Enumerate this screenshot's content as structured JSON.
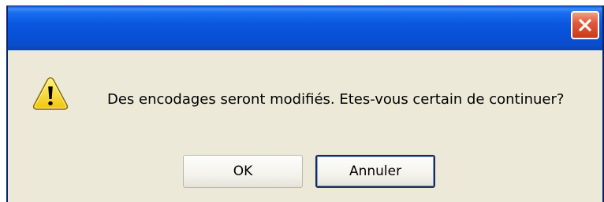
{
  "dialog": {
    "title": "",
    "message": "Des encodages seront modifiés. Etes-vous certain de continuer?",
    "icon": "warning-icon",
    "buttons": {
      "ok_label": "OK",
      "cancel_label": "Annuler"
    }
  },
  "colors": {
    "titlebar": "#0a57de",
    "dialog_bg": "#ece9d8",
    "close_button": "#e2593a",
    "warning_yellow": "#f7d51d"
  }
}
